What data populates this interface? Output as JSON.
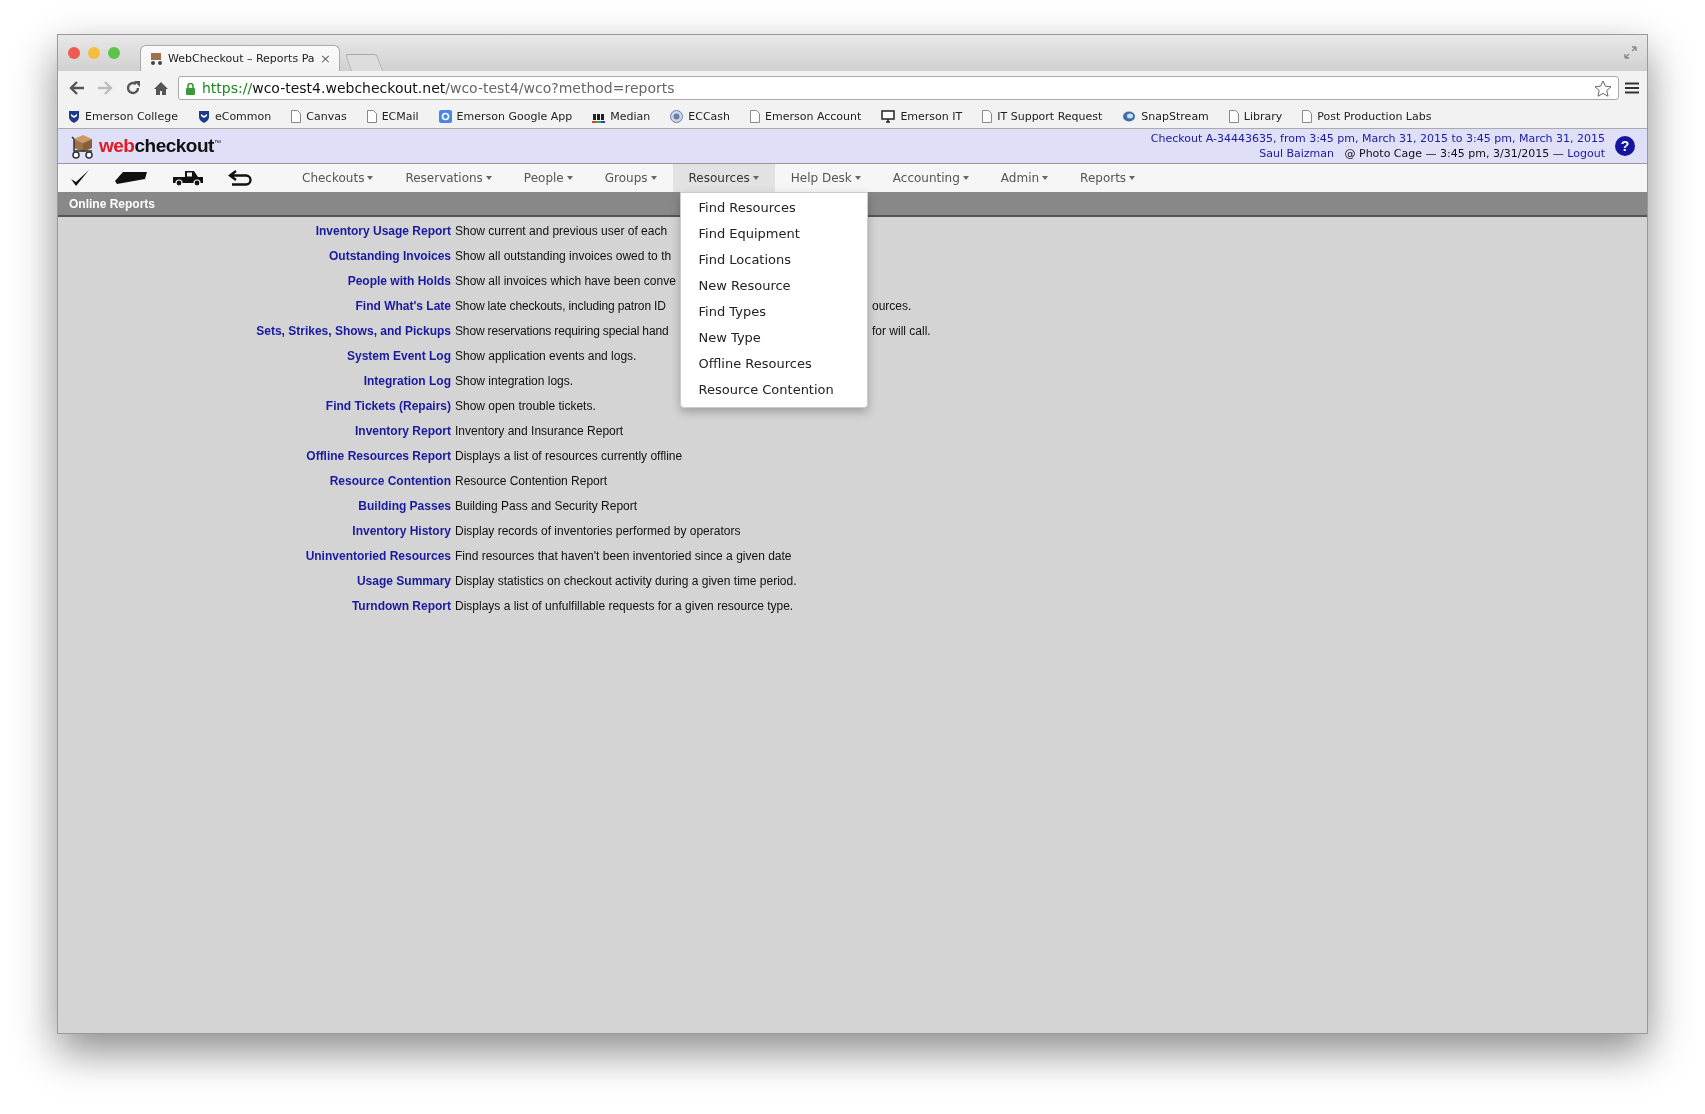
{
  "browser": {
    "tab": {
      "title": "WebCheckout – Reports Pa",
      "close": "×"
    },
    "nav_buttons": [
      {
        "kind": "back",
        "disabled": false
      },
      {
        "kind": "forward",
        "disabled": true
      },
      {
        "kind": "reload",
        "disabled": false
      },
      {
        "kind": "home",
        "disabled": false
      }
    ],
    "address": {
      "scheme": "https://",
      "host": "wco-test4.webcheckout.net",
      "path": "/wco-test4/wco?method=reports"
    },
    "bookmarks": [
      {
        "label": "Emerson College",
        "kind": "shield"
      },
      {
        "label": "eCommon",
        "kind": "shield"
      },
      {
        "label": "Canvas",
        "kind": "page"
      },
      {
        "label": "ECMail",
        "kind": "page"
      },
      {
        "label": "Emerson Google App",
        "kind": "square"
      },
      {
        "label": "Median",
        "kind": "bars"
      },
      {
        "label": "ECCash",
        "kind": "coin"
      },
      {
        "label": "Emerson Account",
        "kind": "page"
      },
      {
        "label": "Emerson IT",
        "kind": "monitor"
      },
      {
        "label": "IT Support Request",
        "kind": "page"
      },
      {
        "label": "SnapStream",
        "kind": "swirl"
      },
      {
        "label": "Library",
        "kind": "page"
      },
      {
        "label": "Post Production Labs",
        "kind": "page"
      }
    ]
  },
  "header": {
    "logo": {
      "prefix": "web",
      "suffix": "checkout",
      "mark": "™"
    },
    "checkout_link": "Checkout A-34443635, from 3:45 pm, March 31, 2015 to 3:45 pm, March 31, 2015",
    "user": "Saul Baizman",
    "location": "@ Photo Cage — 3:45 pm, 3/31/2015 —",
    "logout": "Logout",
    "help": "?"
  },
  "menu": [
    {
      "label": "Checkouts",
      "expanded": false
    },
    {
      "label": "Reservations",
      "expanded": false
    },
    {
      "label": "People",
      "expanded": false
    },
    {
      "label": "Groups",
      "expanded": false
    },
    {
      "label": "Resources",
      "expanded": true,
      "items": [
        "Find Resources",
        "Find Equipment",
        "Find Locations",
        "New Resource",
        "Find Types",
        "New Type",
        "Offline Resources",
        "Resource Contention"
      ]
    },
    {
      "label": "Help Desk",
      "expanded": false
    },
    {
      "label": "Accounting",
      "expanded": false
    },
    {
      "label": "Admin",
      "expanded": false
    },
    {
      "label": "Reports",
      "expanded": false
    }
  ],
  "section_title": "Online Reports",
  "reports": [
    {
      "name": "Inventory Usage Report",
      "description": "Show current and previous user of each"
    },
    {
      "name": "Outstanding Invoices",
      "description": "Show all outstanding invoices owed to th"
    },
    {
      "name": "People with Holds",
      "description": "Show all invoices which have been conve"
    },
    {
      "name": "Find What's Late",
      "description": "Show late checkouts, including patron ID",
      "tail": "ources."
    },
    {
      "name": "Sets, Strikes, Shows, and Pickups",
      "description": "Show reservations requiring special hand",
      "tail": "for will call."
    },
    {
      "name": "System Event Log",
      "description": "Show application events and logs."
    },
    {
      "name": "Integration Log",
      "description": "Show integration logs."
    },
    {
      "name": "Find Tickets (Repairs)",
      "description": "Show open trouble tickets."
    },
    {
      "name": "Inventory Report",
      "description": "Inventory and Insurance Report"
    },
    {
      "name": "Offline Resources Report",
      "description": "Displays a list of resources currently offline"
    },
    {
      "name": "Resource Contention",
      "description": "Resource Contention Report"
    },
    {
      "name": "Building Passes",
      "description": "Building Pass and Security Report"
    },
    {
      "name": "Inventory History",
      "description": "Display records of inventories performed by operators"
    },
    {
      "name": "Uninventoried Resources",
      "description": "Find resources that haven't been inventoried since a given date"
    },
    {
      "name": "Usage Summary",
      "description": "Display statistics on checkout activity during a given time period."
    },
    {
      "name": "Turndown Report",
      "description": "Displays a list of unfulfillable requests for a given resource type."
    }
  ]
}
